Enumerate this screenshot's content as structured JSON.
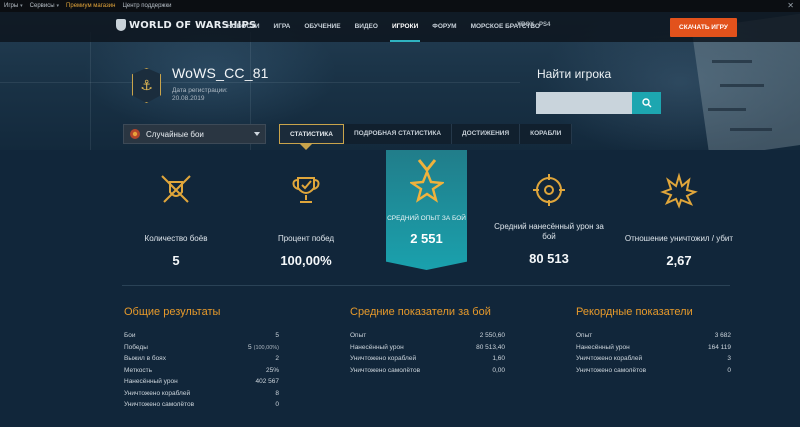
{
  "utility_bar": {
    "games": "Игры",
    "services": "Сервисы",
    "premium_shop": "Премиум магазин",
    "support": "Центр поддержки"
  },
  "nav": {
    "logo_text": "WORLD OF WARSHIPS",
    "items": [
      {
        "label": "НОВОСТИ"
      },
      {
        "label": "ИГРА"
      },
      {
        "label": "ОБУЧЕНИЕ"
      },
      {
        "label": "ВИДЕО"
      },
      {
        "label": "ИГРОКИ"
      },
      {
        "label": "ФОРУМ"
      },
      {
        "label": "МОРСКОЕ БРАТСТВО"
      }
    ],
    "active_index": 4,
    "platforms": [
      "XBOX",
      "PS4"
    ],
    "play_button": "СКАЧАТЬ ИГРУ"
  },
  "player": {
    "nickname": "WoWS_CC_81",
    "reg_label": "Дата регистрации:",
    "reg_date": "20.08.2019"
  },
  "search": {
    "title": "Найти игрока",
    "placeholder": ""
  },
  "mode_select": {
    "value": "Случайные бои"
  },
  "tabs": [
    {
      "label": "СТАТИСТИКА"
    },
    {
      "label": "ПОДРОБНАЯ СТАТИСТИКА"
    },
    {
      "label": "ДОСТИЖЕНИЯ"
    },
    {
      "label": "КОРАБЛИ"
    }
  ],
  "active_tab": 0,
  "stats": [
    {
      "label": "Количество боёв",
      "value": "5",
      "icon": "crossed-swords-icon"
    },
    {
      "label": "Процент побед",
      "value": "100,00%",
      "icon": "trophy-icon"
    },
    {
      "label": "СРЕДНИЙ ОПЫТ ЗА БОЙ",
      "value": "2 551",
      "icon": "medal-star-icon"
    },
    {
      "label": "Средний нанесённый урон за бой",
      "value": "80 513",
      "icon": "crosshair-icon"
    },
    {
      "label": "Отношение уничтожил / убит",
      "value": "2,67",
      "icon": "explosion-icon"
    }
  ],
  "colors": {
    "accent": "#e79a2b",
    "highlight": "#1da6b0",
    "play": "#e2521c"
  },
  "tables": [
    {
      "title": "Общие результаты",
      "rows": [
        {
          "label": "Бои",
          "value": "5",
          "sub": ""
        },
        {
          "label": "Победы",
          "value": "5",
          "sub": "(100,00%)"
        },
        {
          "label": "Выжил в боях",
          "value": "2",
          "sub": ""
        },
        {
          "label": "Меткость",
          "value": "25%",
          "sub": ""
        },
        {
          "label": "Нанесённый урон",
          "value": "402 567",
          "sub": ""
        },
        {
          "label": "Уничтожено кораблей",
          "value": "8",
          "sub": ""
        },
        {
          "label": "Уничтожено самолётов",
          "value": "0",
          "sub": ""
        }
      ]
    },
    {
      "title": "Средние показатели за бой",
      "rows": [
        {
          "label": "Опыт",
          "value": "2 550,60",
          "sub": ""
        },
        {
          "label": "Нанесённый урон",
          "value": "80 513,40",
          "sub": ""
        },
        {
          "label": "Уничтожено кораблей",
          "value": "1,60",
          "sub": ""
        },
        {
          "label": "Уничтожено самолётов",
          "value": "0,00",
          "sub": ""
        }
      ]
    },
    {
      "title": "Рекордные показатели",
      "rows": [
        {
          "label": "Опыт",
          "value": "3 682",
          "sub": ""
        },
        {
          "label": "Нанесённый урон",
          "value": "164 119",
          "sub": ""
        },
        {
          "label": "Уничтожено кораблей",
          "value": "3",
          "sub": ""
        },
        {
          "label": "Уничтожено самолётов",
          "value": "0",
          "sub": ""
        }
      ]
    }
  ]
}
